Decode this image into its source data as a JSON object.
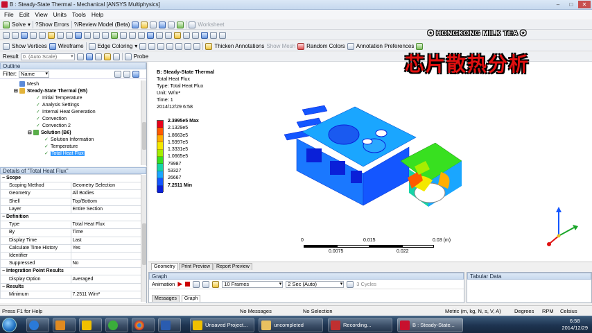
{
  "window": {
    "title": "B : Steady-State Thermal - Mechanical [ANSYS Multiphysics]"
  },
  "menu": [
    "File",
    "Edit",
    "View",
    "Units",
    "Tools",
    "Help"
  ],
  "toolbar1": {
    "solve": "Solve",
    "show_errors": "?Show Errors",
    "review_model": "?/Review Model (Beta)",
    "worksheet": "Worksheet"
  },
  "toolbar2": {
    "show_vertices": "Show Vertices",
    "wireframe": "Wireframe",
    "edge_coloring": "Edge Coloring",
    "thicken": "Thicken Annotations",
    "show_mesh": "Show Mesh",
    "random_colors": "Random Colors",
    "annot_prefs": "Annotation Preferences"
  },
  "toolbar3": {
    "result_label": "Result",
    "result_scale": "0. (Auto Scale)",
    "probe": "Probe"
  },
  "outline": {
    "title": "Outline",
    "filter_label": "Filter:",
    "filter_value": "Name",
    "items": [
      {
        "label": "Mesh"
      },
      {
        "label": "Steady-State Thermal (B5)"
      },
      {
        "label": "Initial Temperature"
      },
      {
        "label": "Analysis Settings"
      },
      {
        "label": "Internal Heat Generation"
      },
      {
        "label": "Convection"
      },
      {
        "label": "Convection 2"
      },
      {
        "label": "Solution (B6)"
      },
      {
        "label": "Solution Information"
      },
      {
        "label": "Temperature"
      },
      {
        "label": "Total Heat Flux"
      }
    ]
  },
  "details": {
    "title": "Details of \"Total Heat Flux\"",
    "rows": [
      {
        "group": "Scope"
      },
      {
        "k": "Scoping Method",
        "v": "Geometry Selection"
      },
      {
        "k": "Geometry",
        "v": "All Bodies"
      },
      {
        "k": "Shell",
        "v": "Top/Bottom"
      },
      {
        "k": "Layer",
        "v": "Entire Section"
      },
      {
        "group": "Definition"
      },
      {
        "k": "Type",
        "v": "Total Heat Flux"
      },
      {
        "k": "By",
        "v": "Time"
      },
      {
        "k": "Display Time",
        "v": "Last"
      },
      {
        "k": "Calculate Time History",
        "v": "Yes"
      },
      {
        "k": "Identifier",
        "v": ""
      },
      {
        "k": "Suppressed",
        "v": "No"
      },
      {
        "group": "Integration Point Results"
      },
      {
        "k": "Display Option",
        "v": "Averaged"
      },
      {
        "group": "Results"
      },
      {
        "k": "Minimum",
        "v": "7.2511 W/m²"
      }
    ]
  },
  "viewport": {
    "info": {
      "title": "B: Steady-State Thermal",
      "type": "Total Heat Flux",
      "type_prefix": "Type: ",
      "unit": "Unit: W/m²",
      "time": "Time: 1",
      "date": "2014/12/29 6:58"
    },
    "legend": {
      "labels": [
        "2.3995e5 Max",
        "2.1329e5",
        "1.8663e5",
        "1.5997e5",
        "1.3331e5",
        "1.0665e5",
        "79987",
        "53327",
        "26667",
        "7.2511 Min"
      ],
      "colors": [
        "#e8001a",
        "#ff5a00",
        "#ffae00",
        "#f4e800",
        "#a6ee00",
        "#38e020",
        "#16d4a8",
        "#1aa6ff",
        "#1456ff",
        "#0a20d8"
      ]
    },
    "scale": {
      "t0": "0",
      "t1": "0.015",
      "t2": "0.03 (m)",
      "b1": "0.0075",
      "b2": "0.022"
    },
    "tabs": [
      "Geometry",
      "Print Preview",
      "Report Preview"
    ]
  },
  "banner": {
    "line1": "✪ HONGKONG MILK TEA ✪",
    "line2": "芯片散热分析"
  },
  "graph": {
    "title": "Graph",
    "animation": "Animation",
    "frames": "10 Frames",
    "duration": "2 Sec (Auto)",
    "cycles": "3 Cycles",
    "tabs": [
      "Messages",
      "Graph"
    ]
  },
  "tabular": {
    "title": "Tabular Data"
  },
  "status": {
    "help": "Press F1 for Help",
    "messages": "No Messages",
    "selection": "No Selection",
    "units": "Metric (m, kg, N, s, V, A)",
    "degrees": "Degrees",
    "rpm": "RPM",
    "celsius": "Celsius"
  },
  "taskbar": {
    "buttons": [
      "Unsaved Project...",
      "uncompleted",
      "Recording...",
      "B : Steady-State..."
    ],
    "time": "6:58",
    "date": "2014/12/29"
  }
}
